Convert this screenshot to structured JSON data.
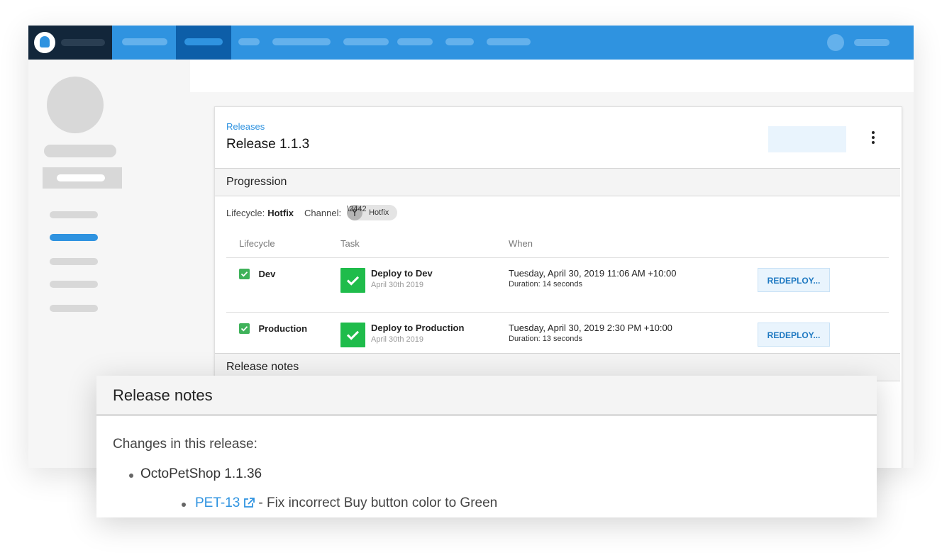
{
  "colors": {
    "brand_blue": "#2f93e0",
    "nav_active": "#0d5ea8",
    "logo_bg": "#12263a",
    "success_green": "#1fbc4b",
    "checkbox_green": "#3fb25a",
    "link_blue": "#2f93e0"
  },
  "breadcrumb": "Releases",
  "title": "Release 1.1.3",
  "progression": {
    "heading": "Progression",
    "lifecycle_label": "Lifecycle:",
    "lifecycle_value": "Hotfix",
    "channel_label": "Channel:",
    "channel_value": "Hotfix",
    "channel_icon": "branch-icon",
    "columns": [
      "Lifecycle",
      "Task",
      "When",
      ""
    ],
    "rows": [
      {
        "environment": "Dev",
        "task_title": "Deploy to Dev",
        "task_date": "April 30th 2019",
        "when": "Tuesday, April 30, 2019 11:06 AM +10:00",
        "duration": "Duration: 14 seconds",
        "action": "REDEPLOY..."
      },
      {
        "environment": "Production",
        "task_title": "Deploy to Production",
        "task_date": "April 30th 2019",
        "when": "Tuesday, April 30, 2019 2:30 PM +10:00",
        "duration": "Duration: 13 seconds",
        "action": "REDEPLOY..."
      }
    ]
  },
  "release_notes": {
    "heading": "Release notes",
    "popup_heading": "Release notes",
    "intro": "Changes in this release:",
    "package": "OctoPetShop 1.1.36",
    "issue_link": "PET-13",
    "issue_icon": "external-link-icon",
    "issue_text": "- Fix incorrect Buy button color to Green"
  }
}
